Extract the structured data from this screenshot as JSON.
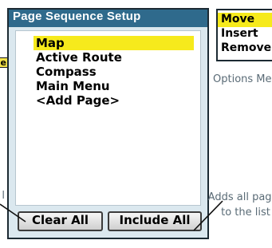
{
  "left_fragments": {
    "tag_text": "e",
    "caption_text": "l"
  },
  "screen": {
    "title": "Page Sequence Setup",
    "pages": [
      {
        "label": "Map",
        "selected": true
      },
      {
        "label": "Active Route",
        "selected": false
      },
      {
        "label": "Compass",
        "selected": false
      },
      {
        "label": "Main Menu",
        "selected": false
      },
      {
        "label": "<Add Page>",
        "selected": false
      }
    ],
    "clear_all_label": "Clear All",
    "include_all_label": "Include All"
  },
  "options_menu": {
    "items": [
      {
        "label": "Move",
        "selected": true
      },
      {
        "label": "Insert",
        "selected": false
      },
      {
        "label": "Remove",
        "selected": false
      }
    ],
    "caption": "Options Menu"
  },
  "callout": {
    "text": "Adds all pages to the list"
  },
  "colors": {
    "title_bar": "#2f6a8c",
    "highlight": "#f6ea1c",
    "screen_bg": "#dbe8ef",
    "caption_text": "#5a6b76"
  }
}
